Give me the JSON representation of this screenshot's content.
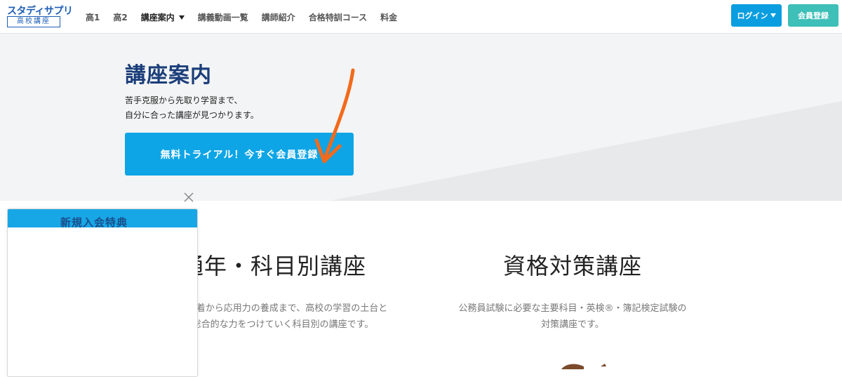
{
  "header": {
    "logo_top": "スタディサプリ",
    "logo_sub": "高校講座",
    "nav": [
      {
        "label": "高1"
      },
      {
        "label": "高2"
      },
      {
        "label": "講座案内"
      },
      {
        "label": "講義動画一覧"
      },
      {
        "label": "講師紹介"
      },
      {
        "label": "合格特訓コース"
      },
      {
        "label": "料金"
      }
    ],
    "login_label": "ログイン",
    "register_label": "会員登録"
  },
  "hero": {
    "title": "講座案内",
    "desc_line1": "苦手克服から先取り学習まで、",
    "desc_line2": "自分に合った講座が見つかります。",
    "cta_label": "無料トライアル！今すぐ会員登録"
  },
  "courses": [
    {
      "title": "通年・科目別講座",
      "desc_line1": "基礎の定着から応用力の養成まで、高校の学習の土台と",
      "desc_line2": "なる総合的な力をつけていく科目別の講座です。"
    },
    {
      "title": "資格対策講座",
      "desc_line1": "公務員試験に必要な主要科目・英検®・簿記検定試験の",
      "desc_line2": "対策講座です。"
    }
  ],
  "popup": {
    "title": "新規入会特典"
  },
  "colors": {
    "brand_blue": "#1d5db5",
    "login_blue": "#0a9ee0",
    "register_teal": "#3ebfb8",
    "cta_blue": "#0ea5e6",
    "hero_title": "#1b3e7a",
    "arrow_orange": "#f26a1b"
  }
}
